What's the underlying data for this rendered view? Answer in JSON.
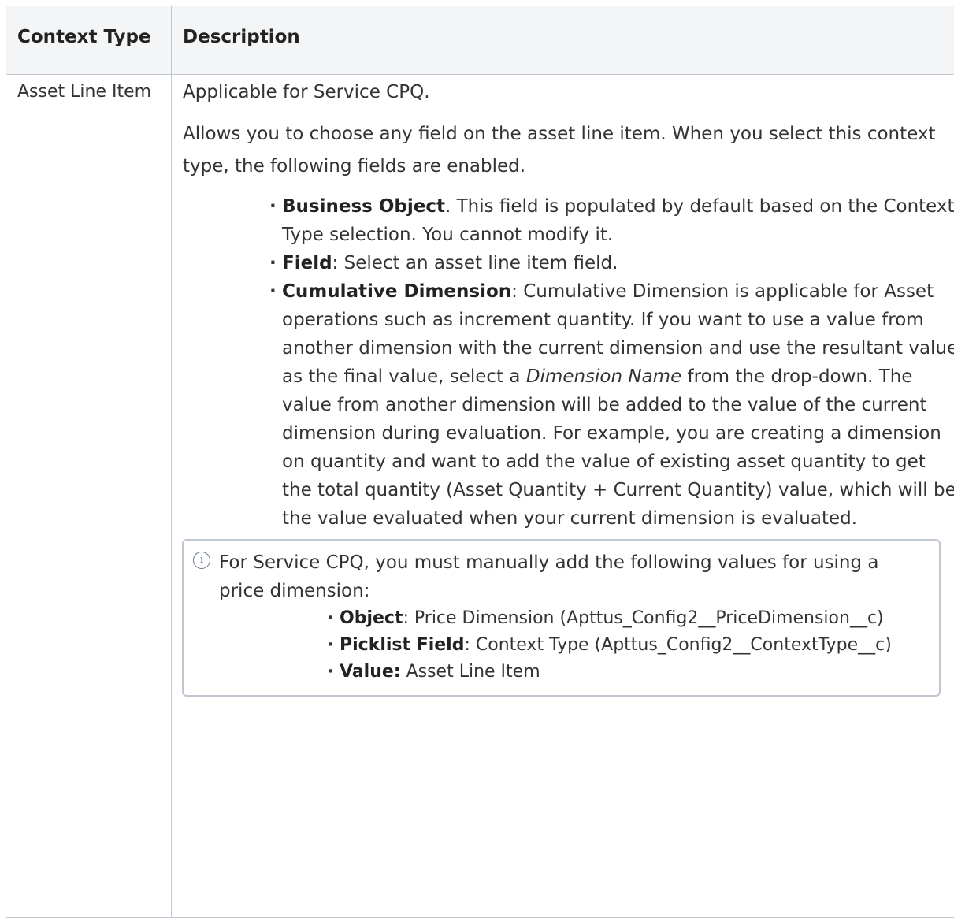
{
  "table": {
    "headers": [
      "Context Type",
      "Description"
    ],
    "row": {
      "context_type": "Asset Line Item",
      "applicable": "Applicable for Service CPQ.",
      "intro": "Allows you to choose any field on the asset line item. When you select this context type, the following fields are enabled.",
      "fields": [
        {
          "term": "Business Object",
          "sep": ".",
          "text": " This field is populated by default based on the Context Type selection. You cannot modify it."
        },
        {
          "term": "Field",
          "sep": ":",
          "text": " Select an asset line item field."
        },
        {
          "term": "Cumulative Dimension",
          "sep": ":",
          "text_before": " Cumulative Dimension is applicable for Asset operations such as increment quantity. If you want to use a value from another dimension with the current dimension and use the resultant value as the final value, select a ",
          "italic": "Dimension Name",
          "text_after": " from the drop-down. The value from another dimension will be added to the value of the current dimension during evaluation. For example, you are creating a dimension on quantity and want to add the value of existing asset quantity to get the total quantity (Asset Quantity + Current Quantity) value, which will be the value evaluated when your current dimension is evaluated."
        }
      ],
      "note": {
        "icon": "info-icon",
        "text": "For Service CPQ, you must manually add the following values for using a price dimension:",
        "items": [
          {
            "term": "Object",
            "sep": ":",
            "text": " Price Dimension (Apttus_Config2__PriceDimension__c)"
          },
          {
            "term": "Picklist Field",
            "sep": ":",
            "text": " Context Type (Apttus_Config2__ContextType__c)"
          },
          {
            "term": "Value:",
            "sep": "",
            "text": " Asset Line Item"
          }
        ]
      }
    }
  }
}
